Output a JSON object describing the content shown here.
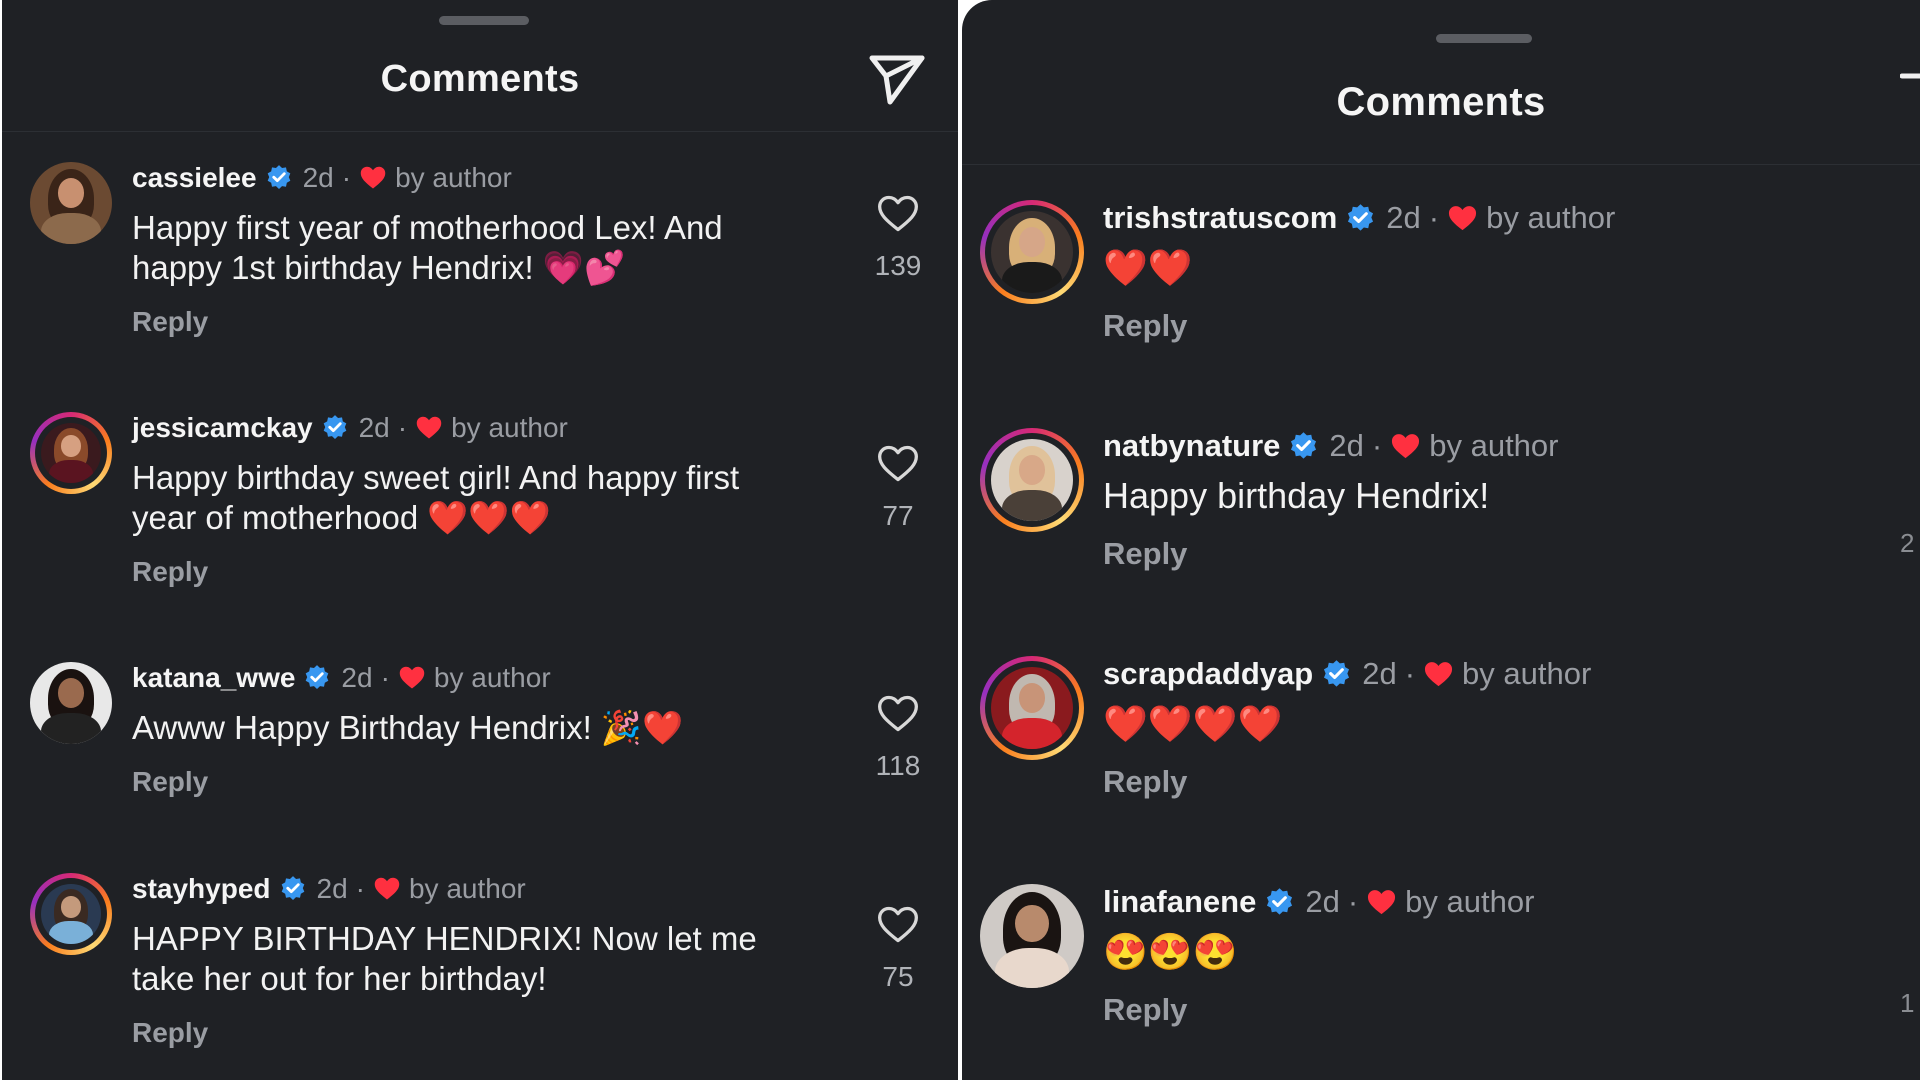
{
  "left_panel": {
    "title": "Comments",
    "comments": [
      {
        "username": "cassielee",
        "time": "2d",
        "author_like": "by author",
        "text_lines": [
          "Happy first year of motherhood Lex! And",
          "happy 1st birthday Hendrix! 💗💕"
        ],
        "reply": "Reply",
        "likes": "139",
        "ring": false,
        "avatar_colors": [
          "#6b4a32",
          "#3a2418",
          "#c89070",
          "#8c6a4c"
        ]
      },
      {
        "username": "jessicamckay",
        "time": "2d",
        "author_like": "by author",
        "text_lines": [
          "Happy birthday sweet girl! And happy first",
          "year of motherhood ❤️❤️❤️"
        ],
        "reply": "Reply",
        "likes": "77",
        "ring": true,
        "avatar_colors": [
          "#3a1a1e",
          "#8a4a2a",
          "#d6a081",
          "#5a1420"
        ]
      },
      {
        "username": "katana_wwe",
        "time": "2d",
        "author_like": "by author",
        "text_lines": [
          "Awww Happy Birthday Hendrix! 🎉❤️"
        ],
        "reply": "Reply",
        "likes": "118",
        "ring": false,
        "avatar_colors": [
          "#e8e8e8",
          "#1a1210",
          "#9a6a4e",
          "#222222"
        ]
      },
      {
        "username": "stayhyped",
        "time": "2d",
        "author_like": "by author",
        "text_lines": [
          "HAPPY BIRTHDAY HENDRIX! Now let me",
          "take her out for her birthday!"
        ],
        "reply": "Reply",
        "likes": "75",
        "ring": true,
        "avatar_colors": [
          "#2a3a52",
          "#3a2a22",
          "#c49a7c",
          "#7ab0d8"
        ]
      }
    ]
  },
  "right_panel": {
    "title": "Comments",
    "comments": [
      {
        "username": "trishstratuscom",
        "time": "2d",
        "author_like": "by author",
        "text_lines": [
          "❤️❤️"
        ],
        "reply": "Reply",
        "ring": true,
        "avatar_colors": [
          "#3a3230",
          "#d8b078",
          "#d6a688",
          "#1a1a1a"
        ]
      },
      {
        "username": "natbynature",
        "time": "2d",
        "author_like": "by author",
        "text_lines": [
          "Happy birthday Hendrix!"
        ],
        "reply": "Reply",
        "ring": true,
        "avatar_colors": [
          "#d8d2cc",
          "#e0c29a",
          "#d8a888",
          "#4a4038"
        ]
      },
      {
        "username": "scrapdaddyap",
        "time": "2d",
        "author_like": "by author",
        "text_lines": [
          "❤️❤️❤️❤️"
        ],
        "reply": "Reply",
        "ring": true,
        "avatar_colors": [
          "#8a1a1e",
          "#c0b8b0",
          "#c89478",
          "#d4242c"
        ]
      },
      {
        "username": "linafanene",
        "time": "2d",
        "author_like": "by author",
        "text_lines": [
          "😍😍😍"
        ],
        "reply": "Reply",
        "ring": false,
        "avatar_colors": [
          "#cfcac6",
          "#1a1412",
          "#b88a6c",
          "#e8d8cc"
        ]
      }
    ],
    "edge_glyphs": [
      "2",
      "1"
    ]
  },
  "icons": {
    "send": "send-icon",
    "like": "heart-outline-icon",
    "verified": "verified-badge-icon",
    "author_heart": "red-heart-icon"
  },
  "colors": {
    "background": "#1f2125",
    "verified_blue": "#3897f0",
    "heart_red": "#ff3040",
    "muted_text": "#9a9da3"
  }
}
